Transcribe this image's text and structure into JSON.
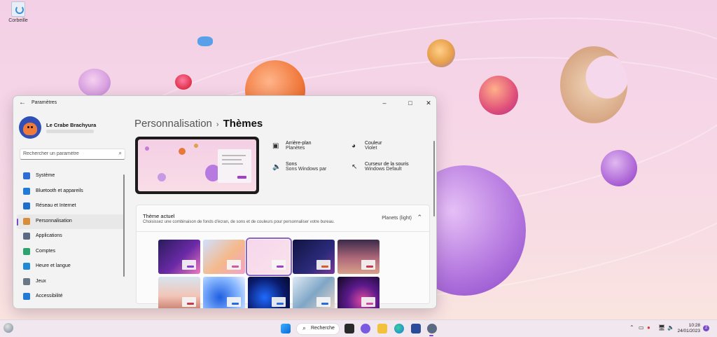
{
  "desktop": {
    "recycle_bin_label": "Corbeille"
  },
  "window": {
    "title": "Paramètres",
    "back_icon": "arrow-left-icon",
    "controls": [
      "minimize",
      "maximize",
      "close"
    ]
  },
  "user": {
    "name": "Le Crabe Brachyura"
  },
  "search": {
    "placeholder": "Rechercher un paramètre"
  },
  "nav": {
    "items": [
      {
        "label": "Système",
        "icon": "system-icon",
        "color": "#2b6cd6"
      },
      {
        "label": "Bluetooth et appareils",
        "icon": "bluetooth-icon",
        "color": "#1f7ad8"
      },
      {
        "label": "Réseau et Internet",
        "icon": "wifi-icon",
        "color": "#1c6fd1"
      },
      {
        "label": "Personnalisation",
        "icon": "brush-icon",
        "color": "#d98c3a",
        "active": true
      },
      {
        "label": "Applications",
        "icon": "apps-icon",
        "color": "#5a6b82"
      },
      {
        "label": "Comptes",
        "icon": "account-icon",
        "color": "#2ea36f"
      },
      {
        "label": "Heure et langue",
        "icon": "globe-clock-icon",
        "color": "#1f8bd6"
      },
      {
        "label": "Jeux",
        "icon": "gamepad-icon",
        "color": "#6b7785"
      },
      {
        "label": "Accessibilité",
        "icon": "accessibility-icon",
        "color": "#1f7ad8"
      }
    ]
  },
  "breadcrumb": {
    "parent": "Personnalisation",
    "separator": "›",
    "current": "Thèmes"
  },
  "properties": {
    "background": {
      "title": "Arrière-plan",
      "value": "Planètes"
    },
    "color": {
      "title": "Couleur",
      "value": "Violet"
    },
    "sounds": {
      "title": "Sons",
      "value": "Sons Windows par"
    },
    "cursor": {
      "title": "Curseur de la souris",
      "value": "Windows Default"
    }
  },
  "current_theme": {
    "title": "Thème actuel",
    "description": "Choisissez une combinaison de fonds d'écran, de sons et de couleurs pour personnaliser votre bureau.",
    "value": "Planets (light)",
    "themes": [
      {
        "name": "theme-glow-dark",
        "bg": "linear-gradient(135deg,#2a1b5c,#6b2aa6 55%,#f07ac0)",
        "accent": "#8b3bd0",
        "selected": false
      },
      {
        "name": "theme-glow-light",
        "bg": "linear-gradient(135deg,#cfe0ff,#f5b98a 55%,#f1a3c9)",
        "accent": "#d05aa0",
        "selected": false
      },
      {
        "name": "theme-planets-light",
        "bg": "linear-gradient(135deg,#f7d6ec,#f8e3ea)",
        "accent": "#a23fc7",
        "selected": true
      },
      {
        "name": "theme-planets-dark",
        "bg": "linear-gradient(135deg,#0f1440,#2a2a7a 60%,#7a3a9a)",
        "accent": "#d85a2a",
        "selected": false
      },
      {
        "name": "theme-sunrise-dark",
        "bg": "linear-gradient(180deg,#3a2a4a,#b06a7a 55%,#d8a08a)",
        "accent": "#c73a4a",
        "selected": false
      },
      {
        "name": "theme-sunrise-light",
        "bg": "linear-gradient(180deg,#d6e4f0,#f2c6b8 55%,#c87a6a)",
        "accent": "#c73a4a",
        "selected": false
      },
      {
        "name": "theme-bloom-light",
        "bg": "radial-gradient(circle at 40% 60%,#1f5fe0,#8ab8ff 60%,#e8f0ff)",
        "accent": "#2a6ae0",
        "selected": false
      },
      {
        "name": "theme-bloom-dark",
        "bg": "radial-gradient(circle at 40% 60%,#1f6aff,#0a1a6a 60%,#050a2a)",
        "accent": "#2a6ae0",
        "selected": false
      },
      {
        "name": "theme-captured-motion",
        "bg": "linear-gradient(135deg,#e0eaf5,#7fa6c6 50%,#f0d8c8)",
        "accent": "#2a6ae0",
        "selected": false
      },
      {
        "name": "theme-flow-dark",
        "bg": "radial-gradient(circle at 60% 70%,#e04aa0,#5a1a8a 45%,#100820)",
        "accent": "#d04aa0",
        "selected": false
      }
    ]
  },
  "taskbar": {
    "search_label": "Recherche",
    "time": "10:28",
    "date": "24/01/2023",
    "notification_count": "2"
  }
}
